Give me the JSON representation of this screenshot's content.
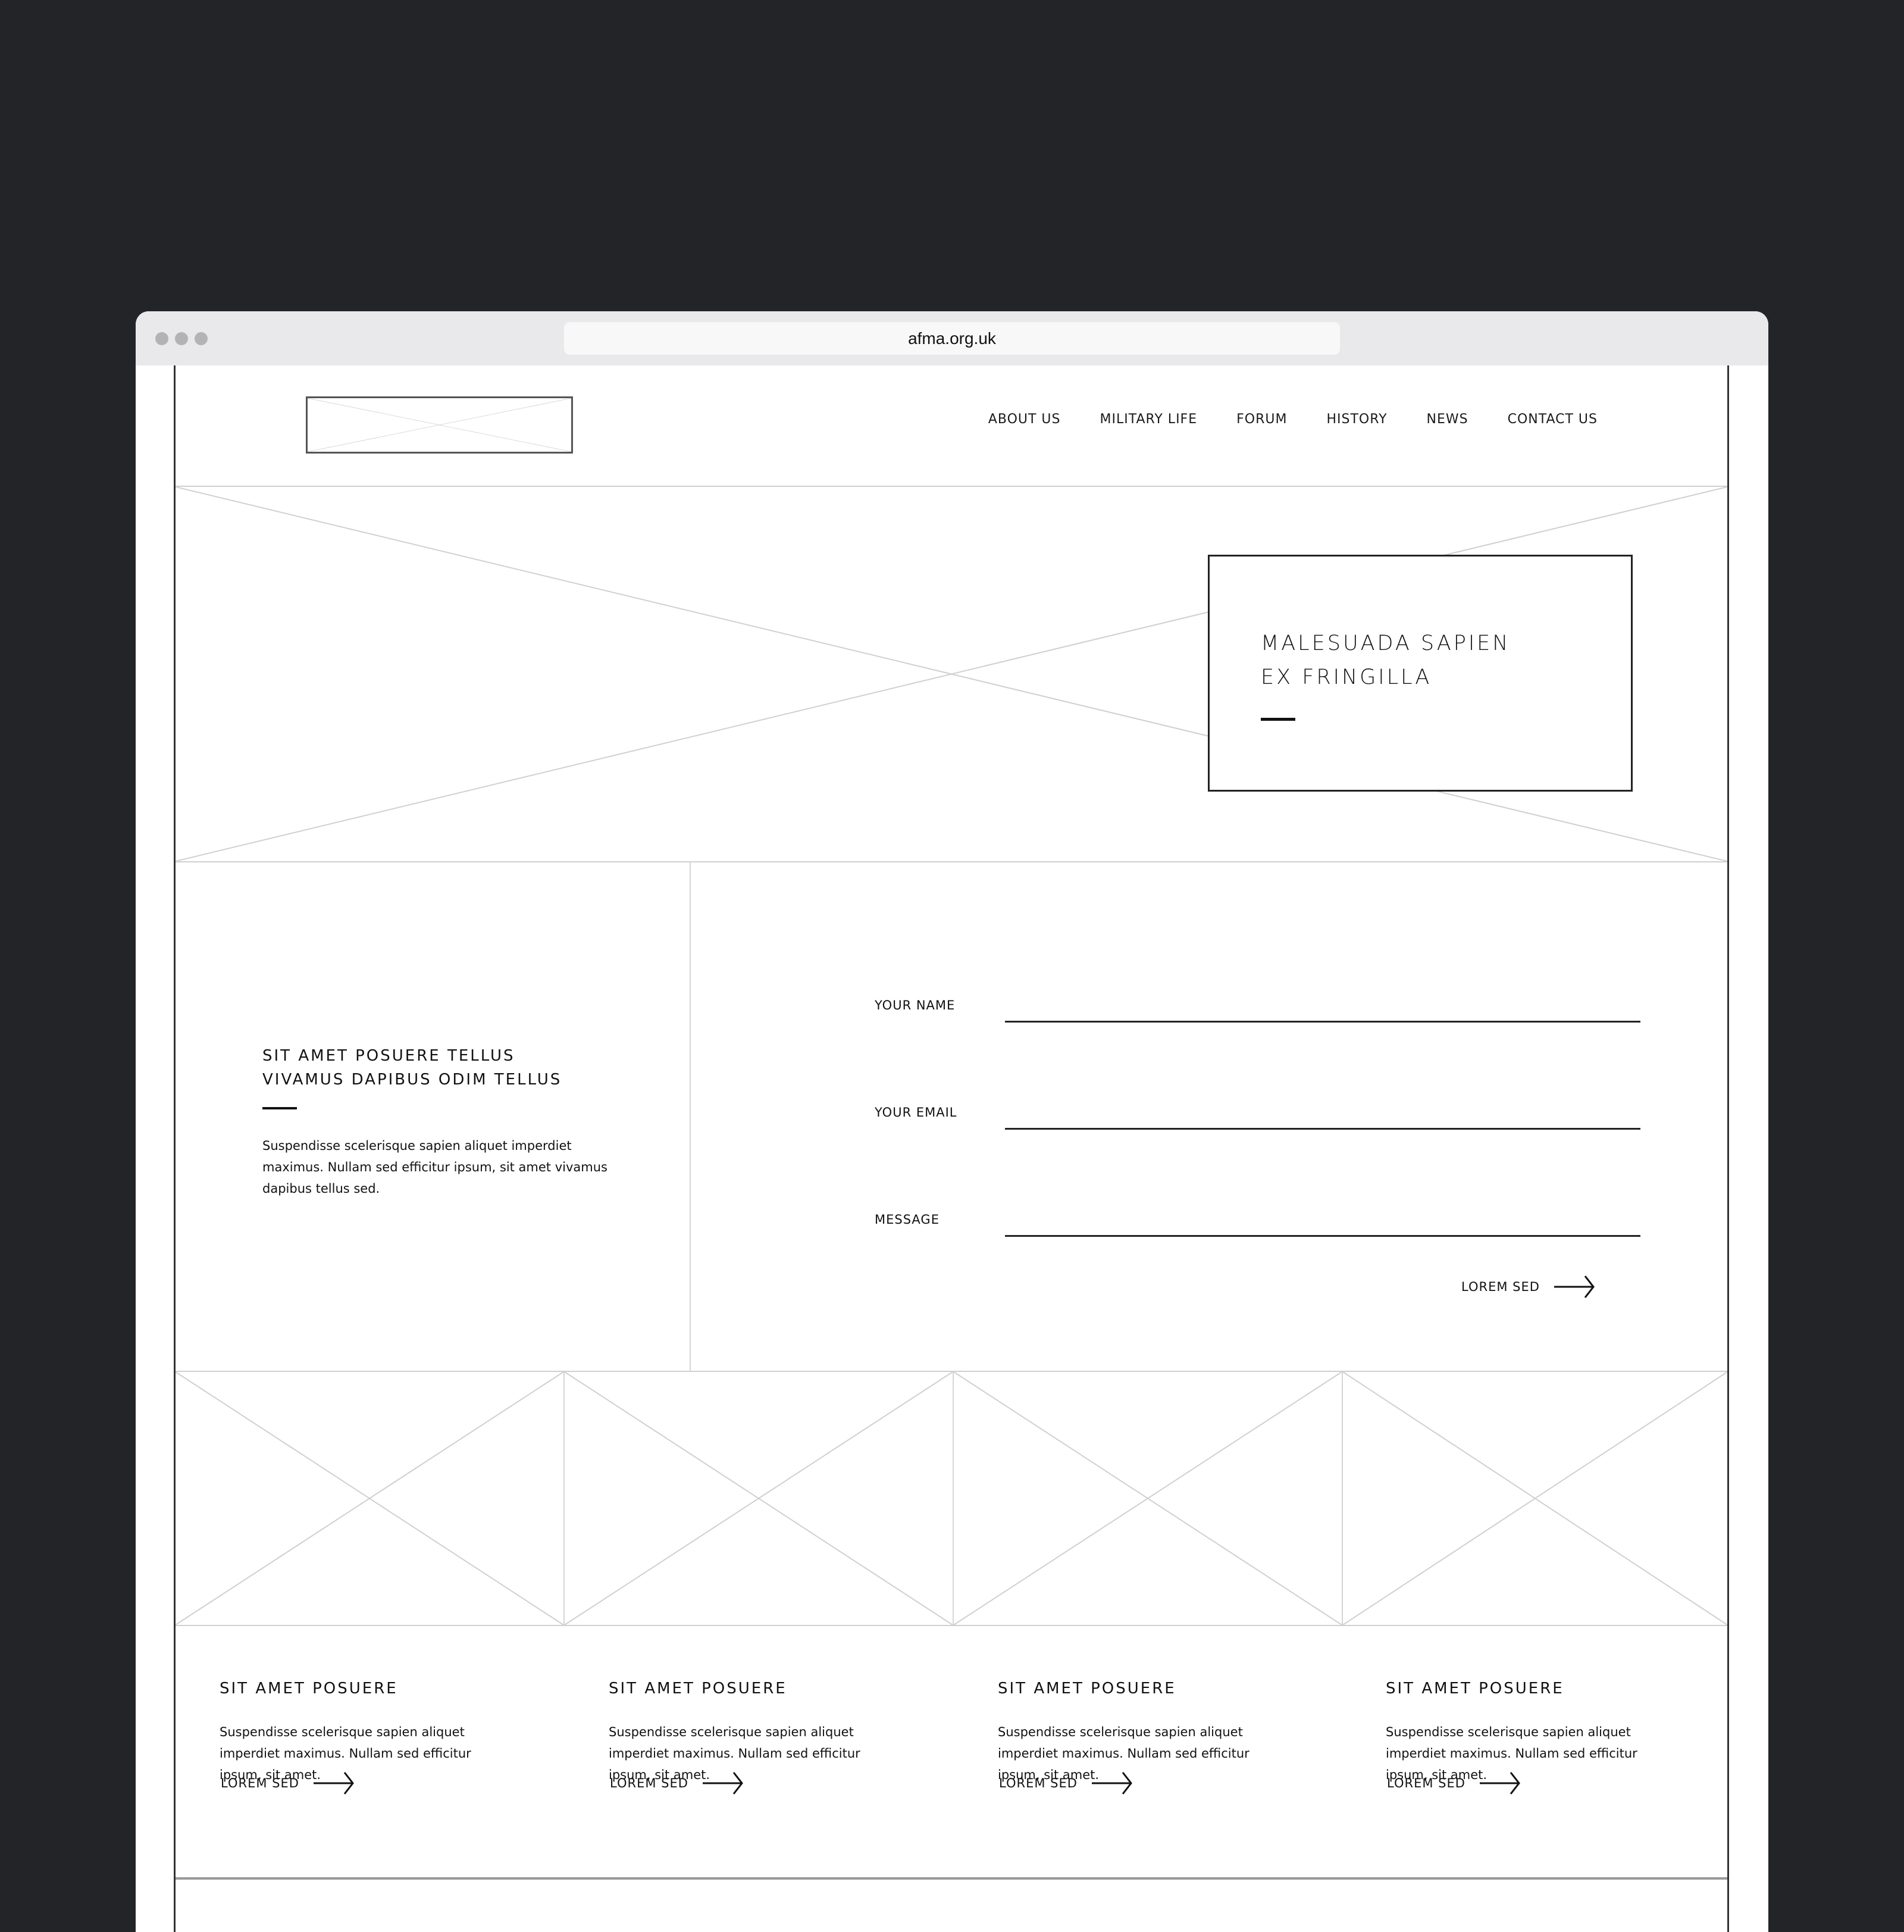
{
  "browser": {
    "url": "afma.org.uk",
    "window_controls": [
      "close",
      "minimize",
      "maximize"
    ]
  },
  "header": {
    "logo_alt": "logo-placeholder",
    "nav": [
      {
        "label": "ABOUT US"
      },
      {
        "label": "MILITARY LIFE"
      },
      {
        "label": "FORUM"
      },
      {
        "label": "HISTORY"
      },
      {
        "label": "NEWS"
      },
      {
        "label": "CONTACT US"
      }
    ]
  },
  "hero": {
    "title_line1": "MALESUADA SAPIEN",
    "title_line2": "EX FRINGILLA"
  },
  "intro": {
    "title_line1": "SIT AMET POSUERE TELLUS",
    "title_line2": "VIVAMUS DAPIBUS ODIM TELLUS",
    "body": "Suspendisse scelerisque sapien aliquet imperdiet maximus. Nullam sed efficitur ipsum, sit amet vivamus dapibus tellus sed."
  },
  "form": {
    "fields": [
      {
        "label": "YOUR NAME",
        "value": "",
        "placeholder": ""
      },
      {
        "label": "YOUR EMAIL",
        "value": "",
        "placeholder": ""
      },
      {
        "label": "MESSAGE",
        "value": "",
        "placeholder": ""
      }
    ],
    "submit_label": "LOREM SED"
  },
  "cards": [
    {
      "title": "SIT AMET POSUERE",
      "body": "Suspendisse scelerisque sapien aliquet imperdiet maximus. Nullam sed efficitur ipsum, sit amet.",
      "link_label": "LOREM SED"
    },
    {
      "title": "SIT AMET POSUERE",
      "body": "Suspendisse scelerisque sapien aliquet imperdiet maximus. Nullam sed efficitur ipsum, sit amet.",
      "link_label": "LOREM SED"
    },
    {
      "title": "SIT AMET POSUERE",
      "body": "Suspendisse scelerisque sapien aliquet imperdiet maximus. Nullam sed efficitur ipsum, sit amet.",
      "link_label": "LOREM SED"
    },
    {
      "title": "SIT AMET POSUERE",
      "body": "Suspendisse scelerisque sapien aliquet imperdiet maximus. Nullam sed efficitur ipsum, sit amet.",
      "link_label": "LOREM SED"
    }
  ],
  "colors": {
    "background": "#222428",
    "chrome": "#e9e9eb",
    "url_bar": "#f8f8f8",
    "placeholder_lines": "#d0d0d0",
    "text": "#111111"
  }
}
